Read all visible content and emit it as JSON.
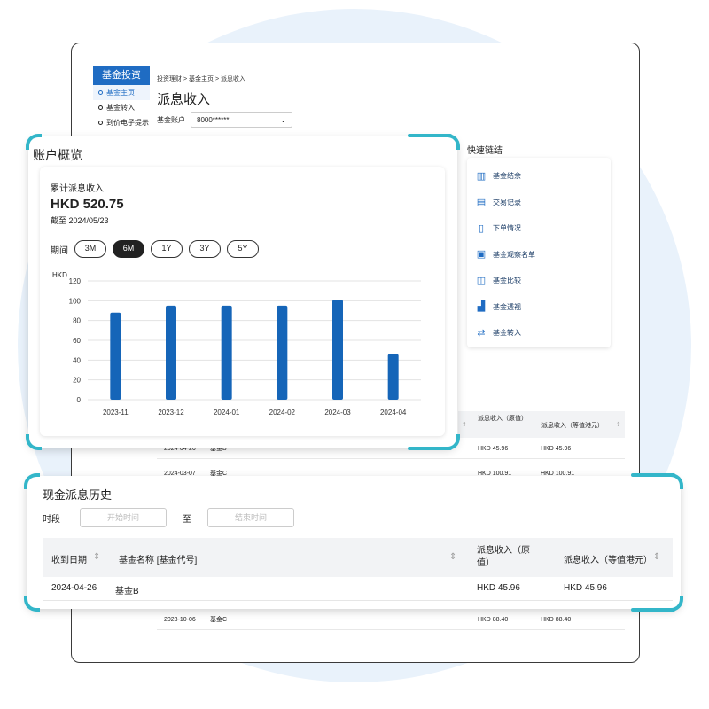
{
  "sidebar": {
    "header": "基金投资",
    "items": [
      {
        "label": "基金主页",
        "active": true
      },
      {
        "label": "基金转入",
        "active": false
      },
      {
        "label": "到价电子提示",
        "active": false
      }
    ]
  },
  "breadcrumb": {
    "items": [
      "投资理财",
      "基金主页",
      "派息收入"
    ],
    "sep": ">"
  },
  "page_title": "派息收入",
  "account": {
    "label": "基金账户",
    "value": "8000******"
  },
  "quick_links": {
    "title": "快速链结",
    "items": [
      {
        "label": "基金结余",
        "icon": "bar-chart-icon"
      },
      {
        "label": "交易记录",
        "icon": "record-icon"
      },
      {
        "label": "下单情况",
        "icon": "clipboard-icon"
      },
      {
        "label": "基金观察名单",
        "icon": "watchlist-icon"
      },
      {
        "label": "基金比较",
        "icon": "compare-icon"
      },
      {
        "label": "基金透视",
        "icon": "insight-icon"
      },
      {
        "label": "基金转入",
        "icon": "transfer-icon"
      }
    ]
  },
  "bg_table": {
    "col_dividend_orig": "派息收入（原值）",
    "col_dividend_hkd": "派息收入（等值港元）",
    "rows": [
      {
        "date": "2024-04-26",
        "fund": "基金B",
        "orig": "HKD 45.96",
        "hkd": "HKD 45.96"
      },
      {
        "date": "2024-03-07",
        "fund": "基金C",
        "orig": "HKD 100.91",
        "hkd": "HKD 100.91"
      },
      {
        "date": "2023-10-06",
        "fund": "基金C",
        "orig": "HKD 88.40",
        "hkd": "HKD 88.40"
      }
    ]
  },
  "overview": {
    "title": "账户概览",
    "cumulative_label": "累计派息收入",
    "amount": "HKD 520.75",
    "as_of": "截至 2024/05/23",
    "period_label": "期间",
    "periods": [
      "3M",
      "6M",
      "1Y",
      "3Y",
      "5Y"
    ],
    "selected_period": "6M"
  },
  "chart_data": {
    "type": "bar",
    "ylabel": "HKD",
    "categories": [
      "2023-11",
      "2023-12",
      "2024-01",
      "2024-02",
      "2024-03",
      "2024-04"
    ],
    "values": [
      88,
      95,
      95,
      95,
      101,
      46
    ],
    "ylim": [
      0,
      120
    ],
    "yticks": [
      0,
      20,
      40,
      60,
      80,
      100,
      120
    ],
    "grid": true,
    "color": "#1565b8"
  },
  "history": {
    "title": "现金派息历史",
    "period_label": "时段",
    "start_placeholder": "开始时间",
    "to_label": "至",
    "end_placeholder": "结束时间",
    "columns": {
      "date": "收到日期",
      "fund": "基金名称 [基金代号]",
      "orig": "派息收入（原值）",
      "hkd": "派息收入（等值港元）"
    },
    "rows": [
      {
        "date": "2024-04-26",
        "fund": "基金B",
        "orig": "HKD 45.96",
        "hkd": "HKD 45.96"
      }
    ]
  },
  "colors": {
    "accent": "#33b6c9",
    "brand": "#1f6cc3",
    "bar": "#1565b8"
  }
}
